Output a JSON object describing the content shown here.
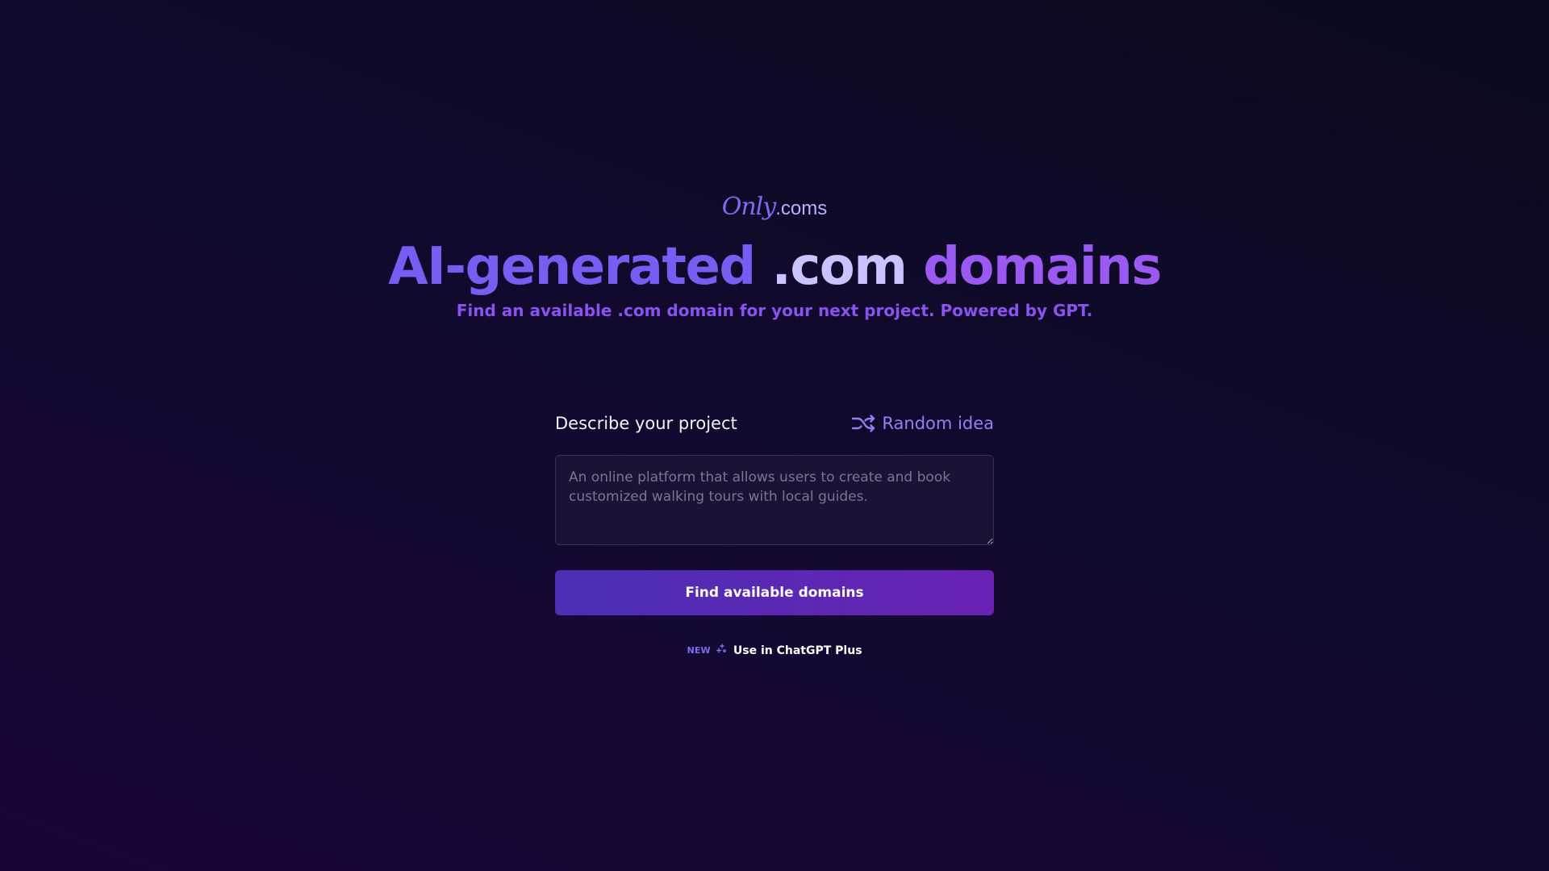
{
  "logo": {
    "script_text": "Only",
    "suffix_text": ".coms"
  },
  "hero": {
    "headline_part1": "AI-generated ",
    "headline_part2": ".com",
    "headline_part3": " domains",
    "subtitle": "Find an available .com domain for your next project. Powered by GPT."
  },
  "form": {
    "label": "Describe your project",
    "random_label": "Random idea",
    "random_icon": "shuffle-icon",
    "description_placeholder": "An online platform that allows users to create and book customized walking tours with local guides.",
    "description_value": "",
    "submit_label": "Find available domains"
  },
  "promo": {
    "badge": "NEW",
    "icon": "sparkle-icon",
    "link_label": "Use in ChatGPT Plus"
  },
  "colors": {
    "accent": "#7c6cf0",
    "button_start": "#4a2fb4",
    "button_end": "#6a22b4",
    "background_top": "#0a0b1e",
    "background_bottom": "#1a0538"
  }
}
